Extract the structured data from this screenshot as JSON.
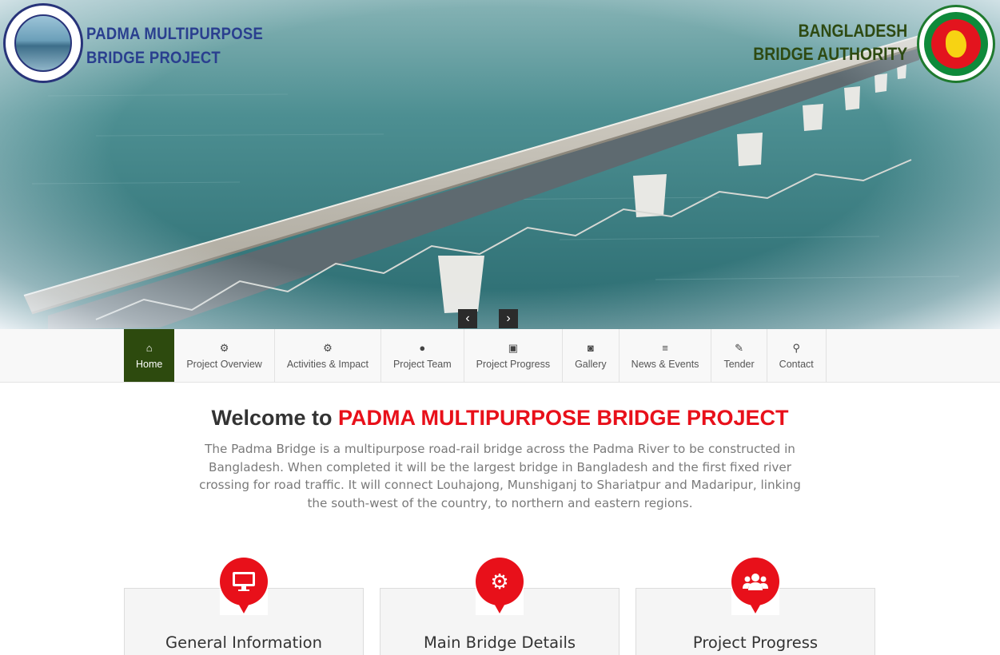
{
  "header": {
    "project_title_line1": "PADMA MULTIPURPOSE",
    "project_title_line2": "BRIDGE PROJECT",
    "authority_line1": "BANGLADESH",
    "authority_line2": "BRIDGE AUTHORITY",
    "left_logo_icon": "padma-bridge-project-logo",
    "right_logo_icon": "bangladesh-government-seal"
  },
  "slider": {
    "prev_label": "‹",
    "next_label": "›"
  },
  "nav": {
    "items": [
      {
        "label": "Home",
        "icon": "home-icon",
        "glyph": "⌂",
        "active": true
      },
      {
        "label": "Project Overview",
        "icon": "cogs-icon",
        "glyph": "⚙"
      },
      {
        "label": "Activities & Impact",
        "icon": "cogs-icon",
        "glyph": "⚙"
      },
      {
        "label": "Project Team",
        "icon": "user-icon",
        "glyph": "●"
      },
      {
        "label": "Project Progress",
        "icon": "picture-icon",
        "glyph": "▣"
      },
      {
        "label": "Gallery",
        "icon": "camera-icon",
        "glyph": "◙"
      },
      {
        "label": "News & Events",
        "icon": "list-icon",
        "glyph": "≡"
      },
      {
        "label": "Tender",
        "icon": "edit-icon",
        "glyph": "✎"
      },
      {
        "label": "Contact",
        "icon": "map-marker-icon",
        "glyph": "⚲"
      }
    ]
  },
  "welcome": {
    "prefix": "Welcome to",
    "brand": "PADMA MULTIPURPOSE BRIDGE PROJECT",
    "intro": "The Padma Bridge is a multipurpose road-rail bridge across the Padma River to be constructed in Bangladesh. When completed it will be the largest bridge in Bangladesh and the first fixed river crossing for road traffic. It will connect Louhajong, Munshiganj to Shariatpur and Madaripur, linking the south-west of the country, to northern and eastern regions."
  },
  "cards": [
    {
      "title": "General Information",
      "icon": "desktop-icon",
      "glyph": "▭"
    },
    {
      "title": "Main Bridge Details",
      "icon": "cogs-icon",
      "glyph": "⚙"
    },
    {
      "title": "Project Progress",
      "icon": "users-icon",
      "glyph": "●"
    }
  ],
  "colors": {
    "accent_red": "#e8101a",
    "nav_active": "#2d4a0e",
    "project_title": "#2a3f8f",
    "authority_title": "#2e4a12"
  }
}
